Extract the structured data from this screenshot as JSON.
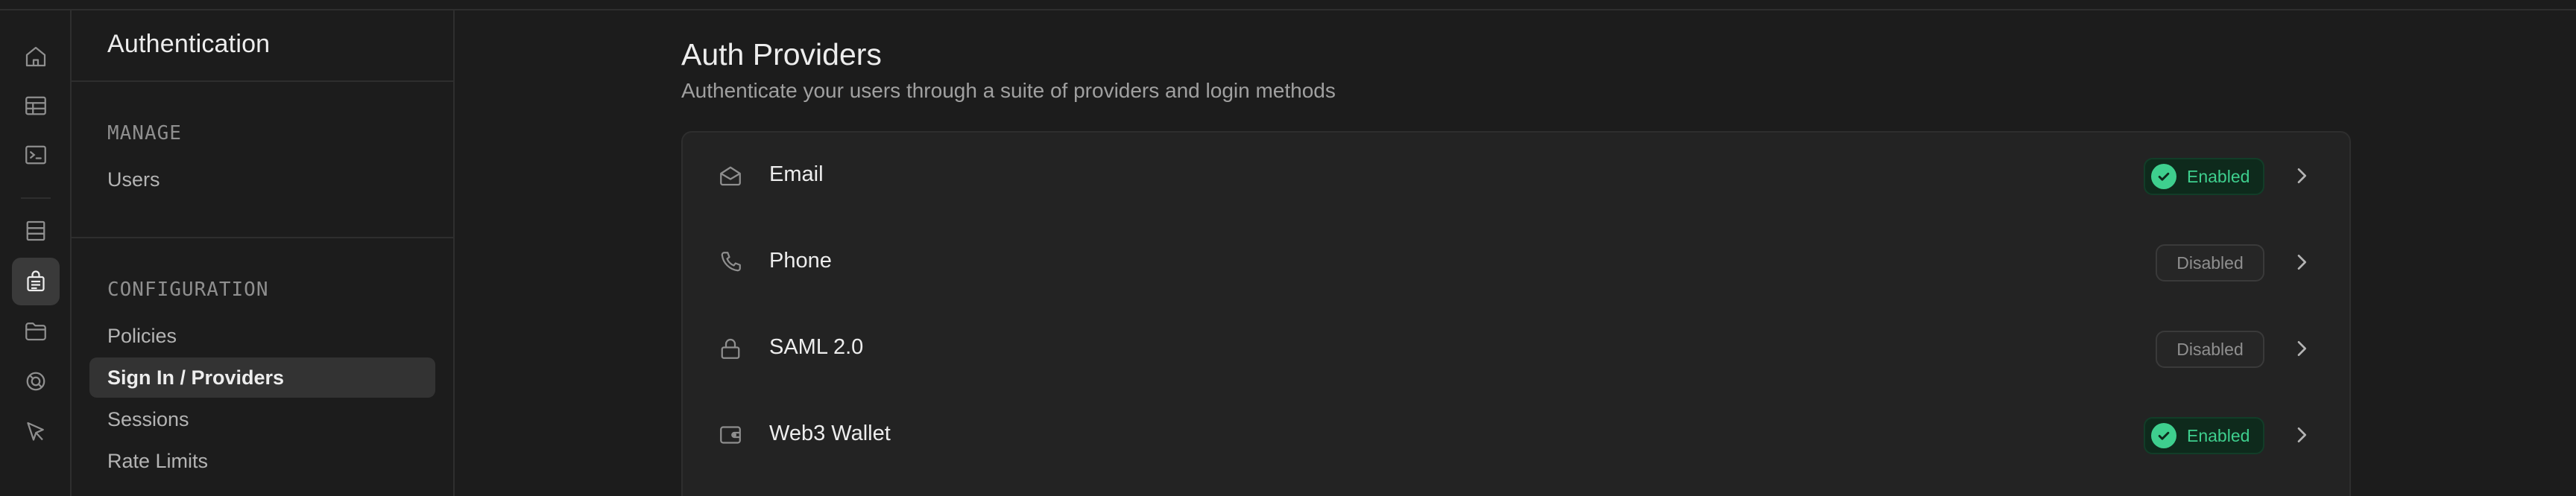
{
  "rail": {
    "items": [
      {
        "icon": "home-icon"
      },
      {
        "icon": "table-editor-icon"
      },
      {
        "icon": "sql-editor-icon"
      },
      {
        "icon": "database-icon"
      },
      {
        "icon": "authentication-icon",
        "active": true
      },
      {
        "icon": "storage-icon"
      },
      {
        "icon": "realtime-icon"
      },
      {
        "icon": "edge-functions-icon"
      }
    ]
  },
  "sidebar": {
    "title": "Authentication",
    "manage_heading": "MANAGE",
    "manage_items": [
      {
        "label": "Users"
      }
    ],
    "config_heading": "CONFIGURATION",
    "config_items": [
      {
        "label": "Policies"
      },
      {
        "label": "Sign In / Providers",
        "active": true
      },
      {
        "label": "Sessions"
      },
      {
        "label": "Rate Limits"
      }
    ]
  },
  "main": {
    "title": "Auth Providers",
    "subtitle": "Authenticate your users through a suite of providers and login methods",
    "providers": [
      {
        "name": "Email",
        "icon": "email-icon",
        "status": "Enabled"
      },
      {
        "name": "Phone",
        "icon": "phone-icon",
        "status": "Disabled"
      },
      {
        "name": "SAML 2.0",
        "icon": "lock-icon",
        "status": "Disabled"
      },
      {
        "name": "Web3 Wallet",
        "icon": "wallet-icon",
        "status": "Enabled"
      }
    ]
  },
  "colors": {
    "background": "#1c1c1c",
    "panel": "#232323",
    "border": "#2e2e2e",
    "accent_green": "#3ecf8e",
    "active_nav": "#333333"
  }
}
